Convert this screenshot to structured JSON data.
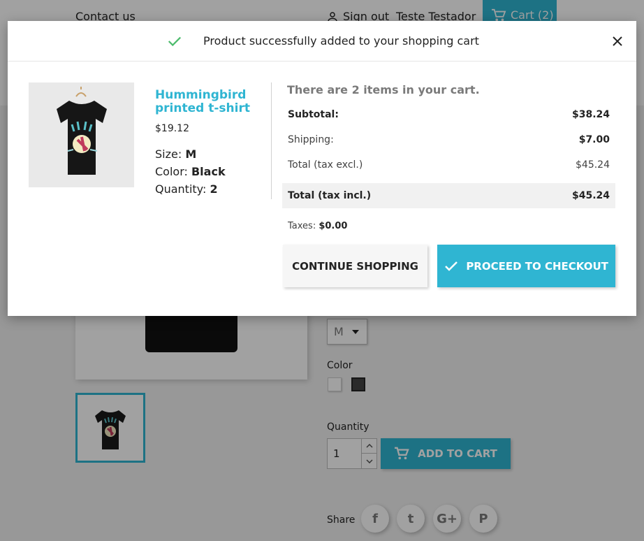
{
  "header": {
    "contact_label": "Contact us",
    "sign_out_label": "Sign out",
    "user_name": "Teste Testador",
    "cart_label": "Cart (2)"
  },
  "product_page": {
    "size_value": "M",
    "color_label": "Color",
    "quantity_label": "Quantity",
    "quantity_value": "1",
    "add_to_cart_label": "ADD TO CART",
    "share_label": "Share",
    "social_icons": [
      "facebook-icon",
      "twitter-icon",
      "google-plus-icon",
      "pinterest-icon"
    ],
    "social_glyphs": [
      "f",
      "t",
      "G+",
      "P"
    ]
  },
  "modal": {
    "title": "Product successfully added to your shopping cart",
    "product": {
      "name": "Hummingbird printed t-shirt",
      "price": "$19.12",
      "size_label": "Size:",
      "size_value": "M",
      "color_label": "Color:",
      "color_value": "Black",
      "quantity_label": "Quantity:",
      "quantity_value": "2"
    },
    "cart_summary": {
      "items_text": "There are 2 items in your cart.",
      "subtotal_label": "Subtotal:",
      "subtotal_value": "$38.24",
      "shipping_label": "Shipping:",
      "shipping_value": "$7.00",
      "total_excl_label": "Total (tax excl.)",
      "total_excl_value": "$45.24",
      "total_incl_label": "Total (tax incl.)",
      "total_incl_value": "$45.24",
      "taxes_label": "Taxes:",
      "taxes_value": "$0.00"
    },
    "continue_label": "CONTINUE SHOPPING",
    "checkout_label": "PROCEED TO CHECKOUT"
  },
  "colors": {
    "accent": "#2fb5d2",
    "success": "#4cbb6c",
    "swatch_white": "#ffffff",
    "swatch_black": "#434343"
  }
}
